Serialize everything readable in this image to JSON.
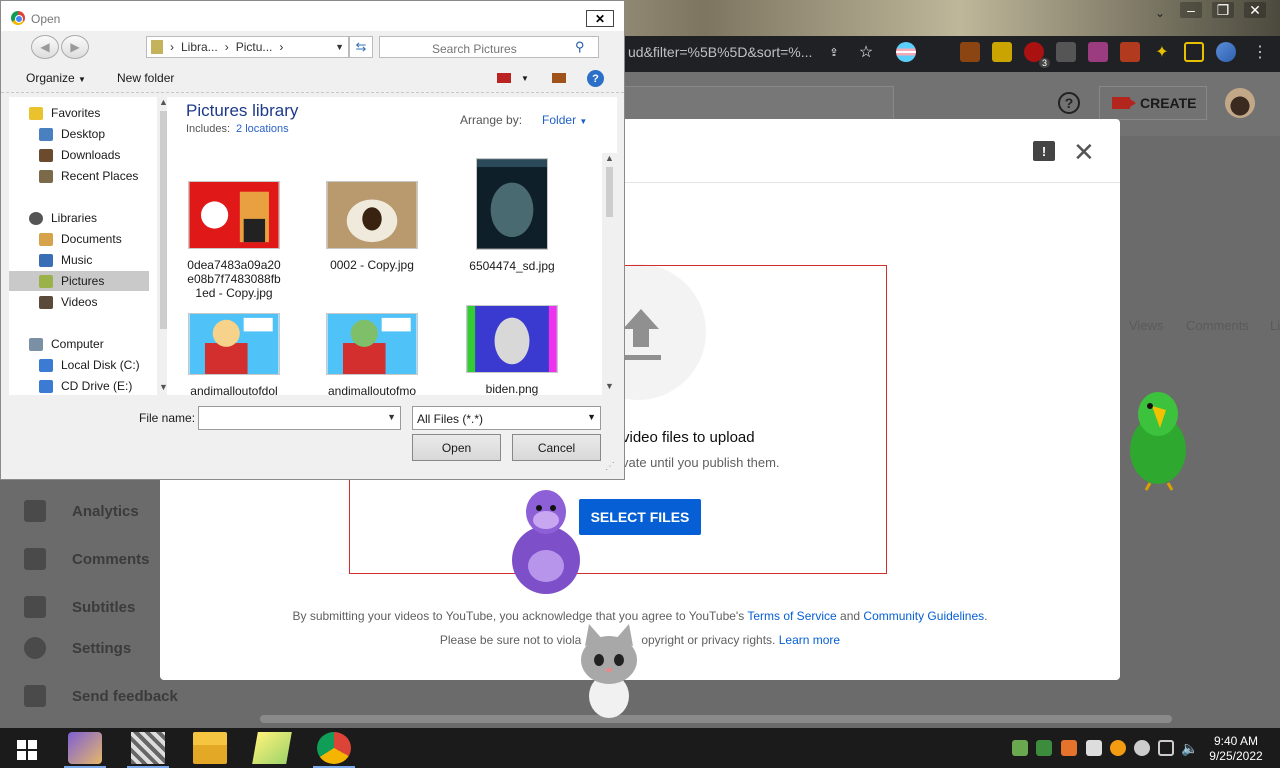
{
  "browser": {
    "url_fragment": "ud&filter=%5B%5D&sort=%...",
    "extension_badge": "3"
  },
  "studio": {
    "create_label": "CREATE",
    "help_glyph": "?",
    "columns": [
      "Views",
      "Comments",
      "Li"
    ],
    "sidebar": [
      {
        "label": "Analytics",
        "icon": "analytics-icon"
      },
      {
        "label": "Comments",
        "icon": "comments-icon"
      },
      {
        "label": "Subtitles",
        "icon": "subtitles-icon"
      },
      {
        "label": "Settings",
        "icon": "gear-icon"
      },
      {
        "label": "Send feedback",
        "icon": "feedback-icon"
      }
    ]
  },
  "upload_modal": {
    "feedback_glyph": "!",
    "close_glyph": "✕",
    "drag_text": "video files to upload",
    "privacy_text": "vate until you publish them.",
    "select_button": "SELECT FILES",
    "terms_prefix": "By submitting your videos to YouTube, you acknowledge that you agree to YouTube's",
    "terms_link": "Terms of Service",
    "terms_and": "and",
    "guidelines_link": "Community Guidelines",
    "terms_end": ".",
    "notice_prefix": "Please be sure not to viola",
    "notice_mid": "opyright or privacy rights.",
    "learn_more": "Learn more"
  },
  "open_dialog": {
    "title": "Open",
    "close_glyph": "✕",
    "breadcrumb": [
      "Libra...",
      "Pictu..."
    ],
    "search_placeholder": "Search Pictures",
    "organize_label": "Organize",
    "new_folder_label": "New folder",
    "help_glyph": "?",
    "nav": {
      "favorites": "Favorites",
      "desktop": "Desktop",
      "downloads": "Downloads",
      "recent": "Recent Places",
      "libraries": "Libraries",
      "documents": "Documents",
      "music": "Music",
      "pictures": "Pictures",
      "videos": "Videos",
      "computer": "Computer",
      "local_disk": "Local Disk (C:)",
      "cd_drive": "CD Drive (E:)"
    },
    "library_title": "Pictures library",
    "includes_label": "Includes:",
    "includes_link": "2 locations",
    "arrange_label": "Arrange by:",
    "arrange_value": "Folder",
    "files": [
      {
        "name": "0dea7483a09a20e08b7f7483088fb1ed - Copy.jpg"
      },
      {
        "name": "0002 - Copy.jpg"
      },
      {
        "name": "6504474_sd.jpg"
      },
      {
        "name": "andimalloutofdol"
      },
      {
        "name": "andimalloutofmo"
      },
      {
        "name": "biden.png"
      }
    ],
    "filename_label": "File name:",
    "filename_value": "",
    "filetype_value": "All Files (*.*)",
    "open_button": "Open",
    "cancel_button": "Cancel"
  },
  "taskbar": {
    "time": "9:40 AM",
    "date": "9/25/2022"
  },
  "colors": {
    "accent": "#065fd4",
    "selection_rect": "#d32f2f",
    "dialog_bg": "#f0f0f0"
  }
}
